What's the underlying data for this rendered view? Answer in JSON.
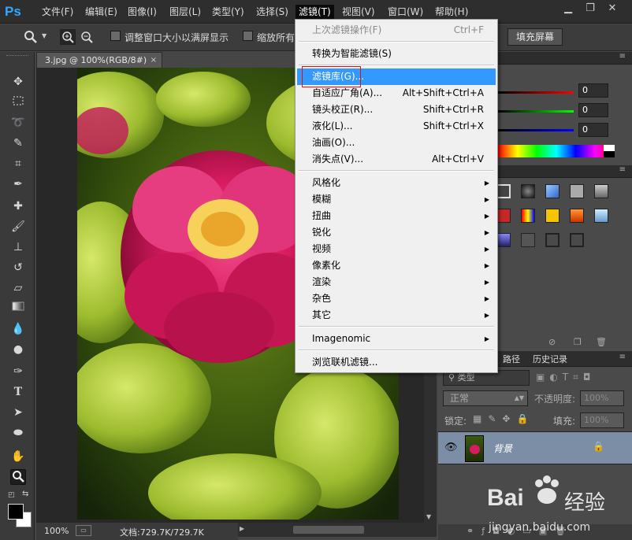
{
  "app": {
    "logo": "Ps"
  },
  "menubar": {
    "items": [
      "文件(F)",
      "编辑(E)",
      "图像(I)",
      "图层(L)",
      "类型(Y)",
      "选择(S)",
      "滤镜(T)",
      "视图(V)",
      "窗口(W)",
      "帮助(H)"
    ],
    "active_index": 6,
    "window_buttons": {
      "minimize": "▁",
      "restore": "❐",
      "close": "✕"
    }
  },
  "options_bar": {
    "checkbox1_label": "调整窗口大小以满屏显示",
    "checkbox2_label": "缩放所有",
    "fill_screen_button": "填充屏幕"
  },
  "document": {
    "tab_title": "3.jpg @ 100%(RGB/8#)",
    "tab_close": "×"
  },
  "status_bar": {
    "zoom": "100%",
    "doc_info": "文档:729.7K/729.7K"
  },
  "filter_menu": {
    "items": [
      {
        "label": "上次滤镜操作(F)",
        "shortcut": "Ctrl+F",
        "disabled": true
      },
      {
        "separator": true
      },
      {
        "label": "转换为智能滤镜(S)",
        "shortcut": ""
      },
      {
        "separator": true
      },
      {
        "label": "滤镜库(G)...",
        "shortcut": "",
        "highlighted": true
      },
      {
        "label": "自适应广角(A)...",
        "shortcut": "Alt+Shift+Ctrl+A"
      },
      {
        "label": "镜头校正(R)...",
        "shortcut": "Shift+Ctrl+R"
      },
      {
        "label": "液化(L)...",
        "shortcut": "Shift+Ctrl+X"
      },
      {
        "label": "油画(O)...",
        "shortcut": ""
      },
      {
        "label": "消失点(V)...",
        "shortcut": "Alt+Ctrl+V"
      },
      {
        "separator": true
      },
      {
        "label": "风格化",
        "submenu": true
      },
      {
        "label": "模糊",
        "submenu": true
      },
      {
        "label": "扭曲",
        "submenu": true
      },
      {
        "label": "锐化",
        "submenu": true
      },
      {
        "label": "视频",
        "submenu": true
      },
      {
        "label": "像素化",
        "submenu": true
      },
      {
        "label": "渲染",
        "submenu": true
      },
      {
        "label": "杂色",
        "submenu": true
      },
      {
        "label": "其它",
        "submenu": true
      },
      {
        "separator": true
      },
      {
        "label": "Imagenomic",
        "submenu": true
      },
      {
        "separator": true
      },
      {
        "label": "浏览联机滤镜...",
        "shortcut": ""
      }
    ]
  },
  "color_panel": {
    "r": "0",
    "g": "0",
    "b": "0"
  },
  "layers_panel": {
    "tabs": [
      "路径",
      "历史记录"
    ],
    "filter_label": "类型",
    "blend_mode": "正常",
    "opacity_label": "不透明度:",
    "opacity_value": "100%",
    "lock_label": "锁定:",
    "fill_label": "填充:",
    "fill_value": "100%",
    "layer_name": "背景"
  },
  "watermark": {
    "brand": "Bai",
    "brand2": "经验",
    "url": "jingyan.baidu.com"
  },
  "colors": {
    "menu_highlight": "#3399ff",
    "ps_blue": "#31a8ff",
    "red_annotation": "#dd1111"
  }
}
